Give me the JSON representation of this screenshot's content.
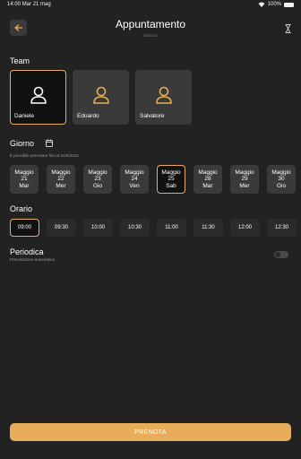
{
  "status": {
    "time": "14:00",
    "date": "Mar 21 mag",
    "battery": "100%"
  },
  "header": {
    "title": "Appuntamento",
    "subtitle": "TAGLIO"
  },
  "team": {
    "label": "Team",
    "members": [
      {
        "name": "Daniele",
        "selected": true
      },
      {
        "name": "Edoardo",
        "selected": false
      },
      {
        "name": "Salvatore",
        "selected": false
      }
    ]
  },
  "day": {
    "label": "Giorno",
    "hint": "È possibile prenotare fino al 31/5/2024",
    "days": [
      {
        "month": "Maggio",
        "num": "21",
        "wd": "Mar",
        "selected": false
      },
      {
        "month": "Maggio",
        "num": "22",
        "wd": "Mer",
        "selected": false
      },
      {
        "month": "Maggio",
        "num": "23",
        "wd": "Gio",
        "selected": false
      },
      {
        "month": "Maggio",
        "num": "24",
        "wd": "Ven",
        "selected": false
      },
      {
        "month": "Maggio",
        "num": "25",
        "wd": "Sab",
        "selected": true
      },
      {
        "month": "Maggio",
        "num": "28",
        "wd": "Mar",
        "selected": false
      },
      {
        "month": "Maggio",
        "num": "29",
        "wd": "Mer",
        "selected": false
      },
      {
        "month": "Maggio",
        "num": "30",
        "wd": "Gio",
        "selected": false
      }
    ]
  },
  "time": {
    "label": "Orario",
    "slots": [
      {
        "value": "09:00",
        "selected": true
      },
      {
        "value": "09:30",
        "selected": false
      },
      {
        "value": "10:00",
        "selected": false
      },
      {
        "value": "10:30",
        "selected": false
      },
      {
        "value": "11:00",
        "selected": false
      },
      {
        "value": "11:30",
        "selected": false
      },
      {
        "value": "12:00",
        "selected": false
      },
      {
        "value": "12:30",
        "selected": false
      }
    ]
  },
  "recurring": {
    "label": "Periodica",
    "hint": "Prenotazione automatica",
    "enabled": false
  },
  "actions": {
    "book_label": "PRENOTA"
  },
  "colors": {
    "accent": "#e8ad5b",
    "background": "#222222",
    "card": "#3a3a3a"
  }
}
